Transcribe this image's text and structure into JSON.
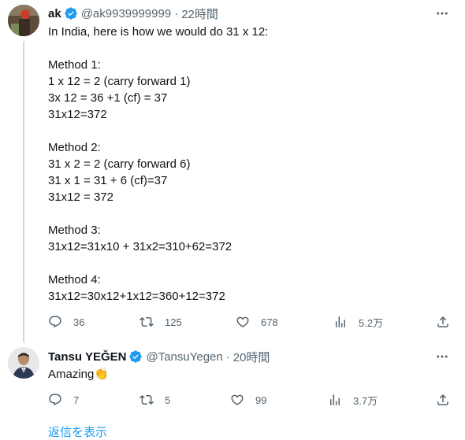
{
  "tweets": [
    {
      "name": "ak",
      "handle": "@ak9939999999",
      "separator": "·",
      "time": "22時間",
      "lines": [
        "In India, here is how we would do 31 x 12:",
        "",
        "Method 1:",
        "1 x 12 = 2 (carry forward 1)",
        "3x 12 = 36 +1 (cf) = 37",
        "31x12=372",
        "",
        "Method 2:",
        "31 x 2 = 2 (carry forward 6)",
        "31 x 1 = 31 + 6 (cf)=37",
        "31x12 = 372",
        "",
        "Method 3:",
        "31x12=31x10 + 31x2=310+62=372",
        "",
        "Method 4:",
        "31x12=30x12+1x12=360+12=372"
      ],
      "actions": {
        "replies": "36",
        "retweets": "125",
        "likes": "678",
        "views": "5.2万"
      }
    },
    {
      "name": "Tansu YEĞEN",
      "handle": "@TansuYegen",
      "separator": "·",
      "time": "20時間",
      "text": "Amazing",
      "emoji": "👏",
      "actions": {
        "replies": "7",
        "retweets": "5",
        "likes": "99",
        "views": "3.7万"
      }
    }
  ],
  "show_replies": "返信を表示",
  "colors": {
    "accent": "#1d9bf0",
    "secondary_text": "#536471",
    "thread_line": "#cfd9de"
  }
}
